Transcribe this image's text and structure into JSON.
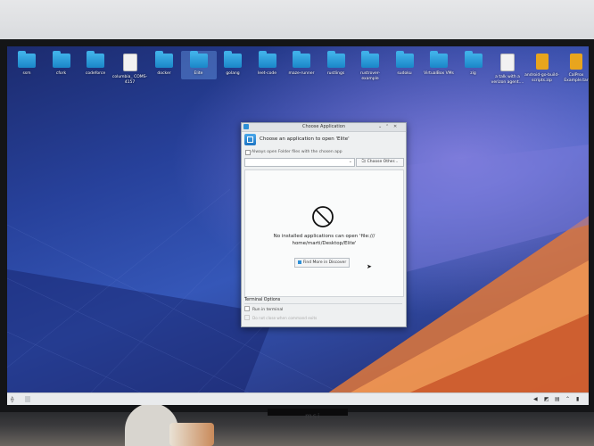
{
  "desktop": {
    "icons": [
      {
        "label": "ssm",
        "type": "folder"
      },
      {
        "label": "cfork",
        "type": "folder"
      },
      {
        "label": "codeforce",
        "type": "folder"
      },
      {
        "label": "columbia_ COMS-4157",
        "type": "doc"
      },
      {
        "label": "docker",
        "type": "folder"
      },
      {
        "label": "Elite",
        "type": "folder",
        "selected": true
      },
      {
        "label": "golang",
        "type": "folder"
      },
      {
        "label": "leet-code",
        "type": "folder"
      },
      {
        "label": "maze-runner",
        "type": "folder"
      },
      {
        "label": "rustlings",
        "type": "folder"
      },
      {
        "label": "rustrover-example",
        "type": "folder"
      },
      {
        "label": "sudoku",
        "type": "folder"
      },
      {
        "label": "VirtualBox VMs",
        "type": "folder"
      },
      {
        "label": "zig",
        "type": "folder"
      },
      {
        "label": "a talk with a verizon agent....",
        "type": "doc"
      },
      {
        "label": "android-go-build-scripts.zip",
        "type": "zip"
      },
      {
        "label": "CalProx Example.tar",
        "type": "zip"
      }
    ]
  },
  "dialog": {
    "title": "Choose Application",
    "prompt": "Choose an application to open 'Elite'",
    "always_open_label": "Always open Folder files with the chosen app",
    "combo_value": "",
    "choose_other_label": "Choose Other...",
    "choose_other_icon": "folder-open-icon",
    "empty_icon": "no-entry-icon",
    "message_line1": "No installed applications can open 'file:///",
    "message_line2": "home/marti/Desktop/Elite'",
    "discover_label": "Find More in Discover",
    "terminal_options_label": "Terminal Options",
    "run_in_terminal_label": "Run in terminal",
    "do_not_close_label": "Do not close when command exits"
  },
  "monitor": {
    "brand": "msi"
  },
  "colors": {
    "folder": "#2a9ad8",
    "accent": "#2d8fd6",
    "wallpaper": "#2a3c8a"
  }
}
